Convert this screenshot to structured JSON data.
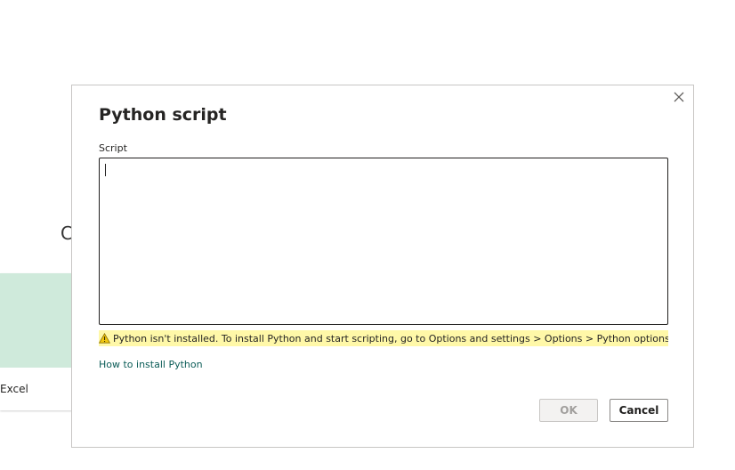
{
  "background": {
    "partial_heading": "C",
    "card_label": "Excel"
  },
  "dialog": {
    "title": "Python script",
    "script_label": "Script",
    "script_value": "",
    "warning_text": "Python isn't installed. To install Python and start scripting, go to Options and settings > Options > Python options.",
    "install_link": "How to install Python",
    "ok_label": "OK",
    "cancel_label": "Cancel",
    "ok_enabled": false
  },
  "icons": {
    "close": "close-icon",
    "warning": "warning-icon"
  },
  "colors": {
    "warning_bg": "#fff8a8",
    "link": "#0b5c57",
    "card_accent": "#cfeadb"
  }
}
